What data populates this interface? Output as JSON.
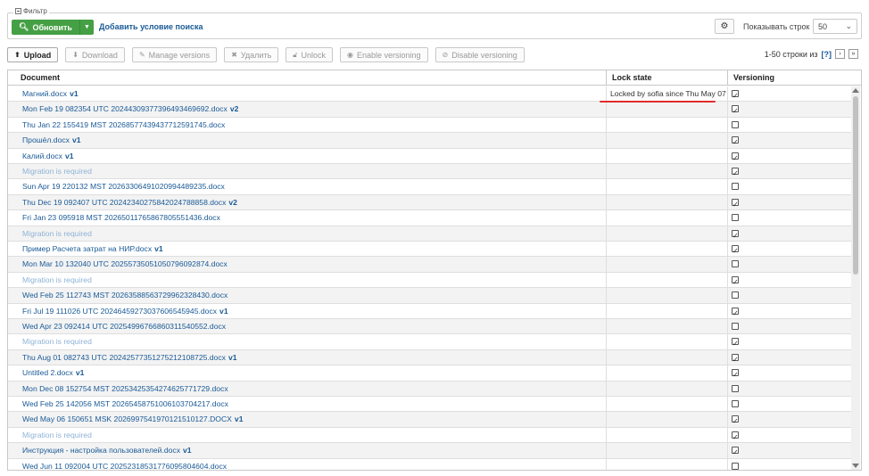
{
  "filter": {
    "legend": "Фильтр",
    "refresh_label": "Обновить",
    "add_condition": "Добавить условие поиска",
    "rows_label": "Показывать строк",
    "rows_value": "50"
  },
  "toolbar": {
    "upload": "Upload",
    "download": "Download",
    "manage_versions": "Manage versions",
    "delete": "Удалить",
    "unlock": "Unlock",
    "enable_versioning": "Enable versioning",
    "disable_versioning": "Disable versioning"
  },
  "paging": {
    "range": "1-50 строки из",
    "help": "[?]"
  },
  "columns": {
    "document": "Document",
    "lock": "Lock state",
    "versioning": "Versioning"
  },
  "rows": [
    {
      "name": "Магний.docx",
      "ver": "v1",
      "lock": "Locked by sofia since Thu May 07",
      "versioning": true,
      "mig": false
    },
    {
      "name": "Mon Feb 19 082354 UTC 2024430937739649346969​2.docx",
      "ver": "v2",
      "lock": "",
      "versioning": true,
      "mig": false
    },
    {
      "name": "Thu Jan 22 155419 MST 2026857743943771259174​5.docx",
      "ver": "",
      "lock": "",
      "versioning": false,
      "mig": false
    },
    {
      "name": "Прошёл.docx",
      "ver": "v1",
      "lock": "",
      "versioning": true,
      "mig": false
    },
    {
      "name": "Калий.docx",
      "ver": "v1",
      "lock": "",
      "versioning": true,
      "mig": false
    },
    {
      "name": "Migration is required",
      "ver": "",
      "lock": "",
      "versioning": true,
      "mig": true
    },
    {
      "name": "Sun Apr 19 220132 MST 2026330649102099448923​5.docx",
      "ver": "",
      "lock": "",
      "versioning": false,
      "mig": false
    },
    {
      "name": "Thu Dec 19 092407 UTC 2024234027584202478885​8.docx",
      "ver": "v2",
      "lock": "",
      "versioning": true,
      "mig": false
    },
    {
      "name": "Fri Jan 23 095918 MST 2026501176586780555143​6.docx",
      "ver": "",
      "lock": "",
      "versioning": false,
      "mig": false
    },
    {
      "name": "Migration is required",
      "ver": "",
      "lock": "",
      "versioning": true,
      "mig": true
    },
    {
      "name": "Пример Расчета затрат на НИР.docx",
      "ver": "v1",
      "lock": "",
      "versioning": true,
      "mig": false
    },
    {
      "name": "Mon Mar 10 132040 UTC 2025573505105079609287​4.docx",
      "ver": "",
      "lock": "",
      "versioning": false,
      "mig": false
    },
    {
      "name": "Migration is required",
      "ver": "",
      "lock": "",
      "versioning": true,
      "mig": true
    },
    {
      "name": "Wed Feb 25 112743 MST 2026358856372996232843​0.docx",
      "ver": "",
      "lock": "",
      "versioning": false,
      "mig": false
    },
    {
      "name": "Fri Jul 19 111026 UTC 2024645927303760654594​5.docx",
      "ver": "v1",
      "lock": "",
      "versioning": true,
      "mig": false
    },
    {
      "name": "Wed Apr 23 092414 UTC 2025499676686031154055​2.docx",
      "ver": "",
      "lock": "",
      "versioning": false,
      "mig": false
    },
    {
      "name": "Migration is required",
      "ver": "",
      "lock": "",
      "versioning": true,
      "mig": true
    },
    {
      "name": "Thu Aug 01 082743 UTC 2024257735127521210872​5.docx",
      "ver": "v1",
      "lock": "",
      "versioning": true,
      "mig": false
    },
    {
      "name": "Untitled 2.docx",
      "ver": "v1",
      "lock": "",
      "versioning": true,
      "mig": false
    },
    {
      "name": "Mon Dec 08 152754 MST 2025342535427462577172​9.docx",
      "ver": "",
      "lock": "",
      "versioning": false,
      "mig": false
    },
    {
      "name": "Wed Feb 25 142056 MST 2026545875100610370421​7.docx",
      "ver": "",
      "lock": "",
      "versioning": false,
      "mig": false
    },
    {
      "name": "Wed May 06 150651 MSK 2026997541970121510127.DOCX",
      "ver": "v1",
      "lock": "",
      "versioning": true,
      "mig": false
    },
    {
      "name": "Migration is required",
      "ver": "",
      "lock": "",
      "versioning": true,
      "mig": true
    },
    {
      "name": "Инструкция - настройка пользователей.docx",
      "ver": "v1",
      "lock": "",
      "versioning": true,
      "mig": false
    },
    {
      "name": "Wed Jun 11 092004 UTC 2025231853177609580460​4.docx",
      "ver": "",
      "lock": "",
      "versioning": false,
      "mig": false
    }
  ]
}
